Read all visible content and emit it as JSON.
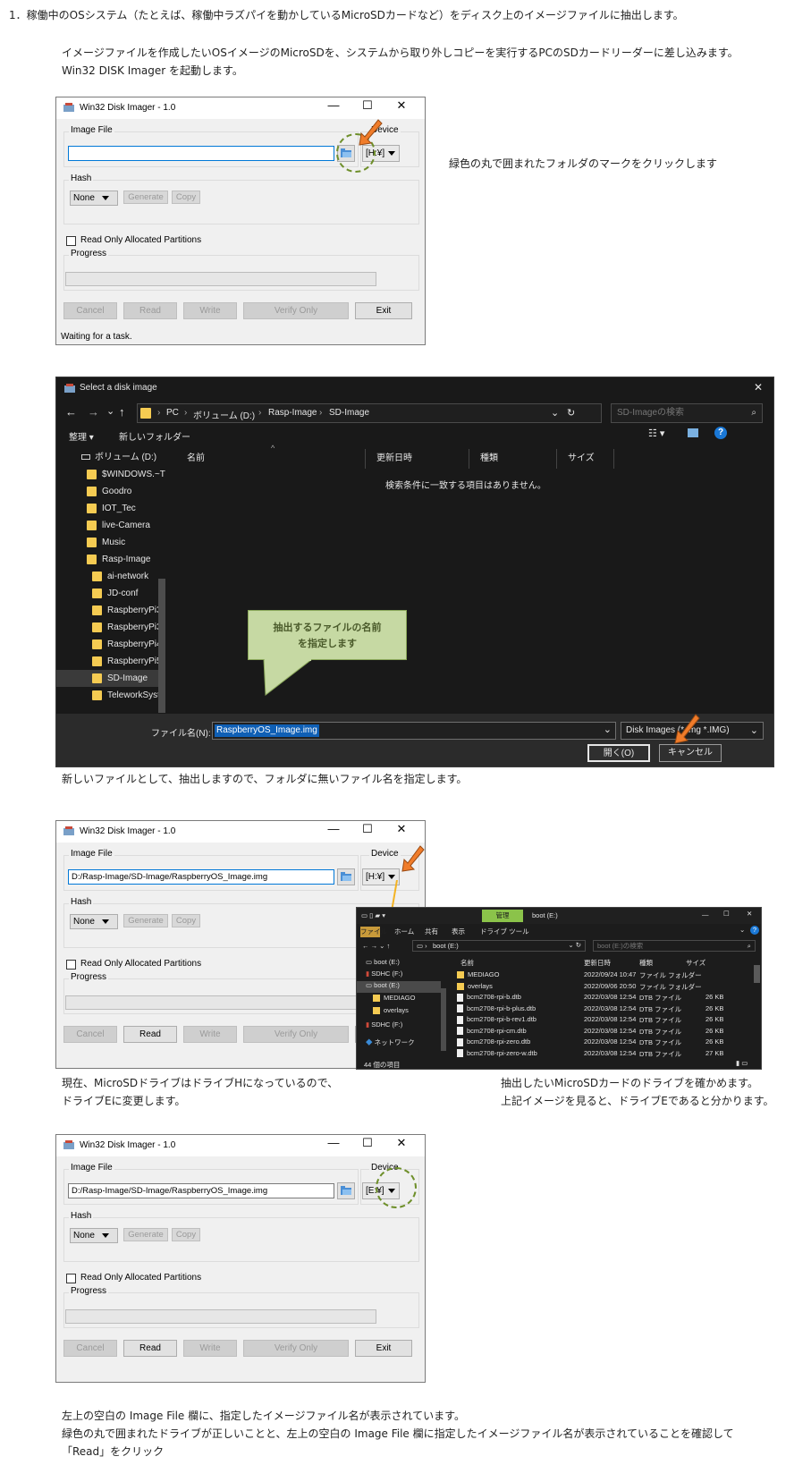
{
  "step1_heading": "1．稼働中のOSシステム（たとえば、稼働中ラズパイを動かしているMicroSDカードなど）をディスク上のイメージファイルに抽出します。",
  "intro_line1": "イメージファイルを作成したいOSイメージのMicroSDを、システムから取り外しコピーを実行するPCのSDカードリーダーに差し込みます。",
  "intro_line2": "Win32 DISK Imager を起動します。",
  "note_folder": "緑色の丸で囲まれたフォルダのマークをクリックします",
  "imager": {
    "title": "Win32 Disk Imager - 1.0",
    "minimize": "—",
    "maximize": "☐",
    "close": "✕",
    "image_file_label": "Image File",
    "device_label": "Device",
    "hash_label": "Hash",
    "hash_value": "None",
    "generate": "Generate",
    "copy": "Copy",
    "read_only": "Read Only Allocated Partitions",
    "progress": "Progress",
    "cancel": "Cancel",
    "read": "Read",
    "write": "Write",
    "verify": "Verify Only",
    "exit": "Exit",
    "status": "Waiting for a task."
  },
  "window1": {
    "image_path": "",
    "device": "[H:¥]"
  },
  "window2": {
    "image_path": "D:/Rasp-Image/SD-Image/RaspberryOS_Image.img",
    "device": "[H:¥]"
  },
  "window3": {
    "image_path": "D:/Rasp-Image/SD-Image/RaspberryOS_Image.img",
    "device": "[E:¥]"
  },
  "dialog": {
    "title": "Select a disk image",
    "close": "✕",
    "nav_back": "←",
    "nav_forward": "→",
    "nav_recent": "⌄",
    "nav_up": "↑",
    "path": [
      "PC",
      "ボリューム (D:)",
      "Rasp-Image",
      "SD-Image"
    ],
    "search_placeholder": "SD-Imageの検索",
    "organize": "整理 ▾",
    "new_folder": "新しいフォルダー",
    "tree_items": [
      "ボリューム (D:)",
      "$WINDOWS.~T",
      "Goodro",
      "IOT_Tec",
      "live-Camera",
      "Music",
      "Rasp-Image",
      "ai-network",
      "JD-conf",
      "RaspberryPi3A",
      "RaspberryPi3B",
      "RaspberryPi4",
      "RaspberryPi5",
      "SD-Image",
      "TeleworkSyste"
    ],
    "col_name": "名前",
    "col_date": "更新日時",
    "col_type": "種類",
    "col_size": "サイズ",
    "empty_message": "検索条件に一致する項目はありません。",
    "filename_label": "ファイル名(N):",
    "filename_value": "RaspberryOS_Image.img",
    "filetype": "Disk Images (*.img *.IMG)",
    "open": "開く(O)",
    "cancel": "キャンセル"
  },
  "callout_line1": "抽出するファイルの名前",
  "callout_line2": "を指定します",
  "note_newfile": "新しいファイルとして、抽出しますので、フォルダに無いファイル名を指定します。",
  "explorer": {
    "ribbon_tab": "管理",
    "title": "boot (E:)",
    "tabs": [
      "ファイル",
      "ホーム",
      "共有",
      "表示",
      "ドライブ ツール"
    ],
    "path": "boot (E:)",
    "search": "boot (E:)の検索",
    "tree": [
      "boot (E:)",
      "SDHC (F:)",
      "boot (E:)",
      "MEDIAGO",
      "overlays",
      "SDHC (F:)",
      "ネットワーク"
    ],
    "cols": [
      "名前",
      "更新日時",
      "種類",
      "サイズ"
    ],
    "files": [
      {
        "name": "MEDIAGO",
        "date": "2022/09/24 10:47",
        "type": "ファイル フォルダー",
        "size": ""
      },
      {
        "name": "overlays",
        "date": "2022/09/06 20:50",
        "type": "ファイル フォルダー",
        "size": ""
      },
      {
        "name": "bcm2708-rpi-b.dtb",
        "date": "2022/03/08 12:54",
        "type": "DTB ファイル",
        "size": "26 KB"
      },
      {
        "name": "bcm2708-rpi-b-plus.dtb",
        "date": "2022/03/08 12:54",
        "type": "DTB ファイル",
        "size": "26 KB"
      },
      {
        "name": "bcm2708-rpi-b-rev1.dtb",
        "date": "2022/03/08 12:54",
        "type": "DTB ファイル",
        "size": "26 KB"
      },
      {
        "name": "bcm2708-rpi-cm.dtb",
        "date": "2022/03/08 12:54",
        "type": "DTB ファイル",
        "size": "26 KB"
      },
      {
        "name": "bcm2708-rpi-zero.dtb",
        "date": "2022/03/08 12:54",
        "type": "DTB ファイル",
        "size": "26 KB"
      },
      {
        "name": "bcm2708-rpi-zero-w.dtb",
        "date": "2022/03/08 12:54",
        "type": "DTB ファイル",
        "size": "27 KB"
      }
    ],
    "count": "44 個の項目"
  },
  "note_drive_left1": "現在、MicroSDドライブはドライブHになっているので、",
  "note_drive_left2": "ドライブEに変更します。",
  "note_drive_right1": "抽出したいMicroSDカードのドライブを確かめます。",
  "note_drive_right2": "上記イメージを見ると、ドライブEであると分かります。",
  "final_line1": "左上の空白の Image File 欄に、指定したイメージファイル名が表示されています。",
  "final_line2": "緑色の丸で囲まれたドライブが正しいことと、左上の空白の Image File 欄に指定したイメージファイル名が表示されていることを確認して",
  "final_line3": "「Read」をクリック",
  "colors": {
    "accent_green": "#6e8f2a",
    "arrow_orange": "#f07c2a",
    "link_yellow": "#f3b323",
    "selection_blue": "#0f5fb5"
  }
}
